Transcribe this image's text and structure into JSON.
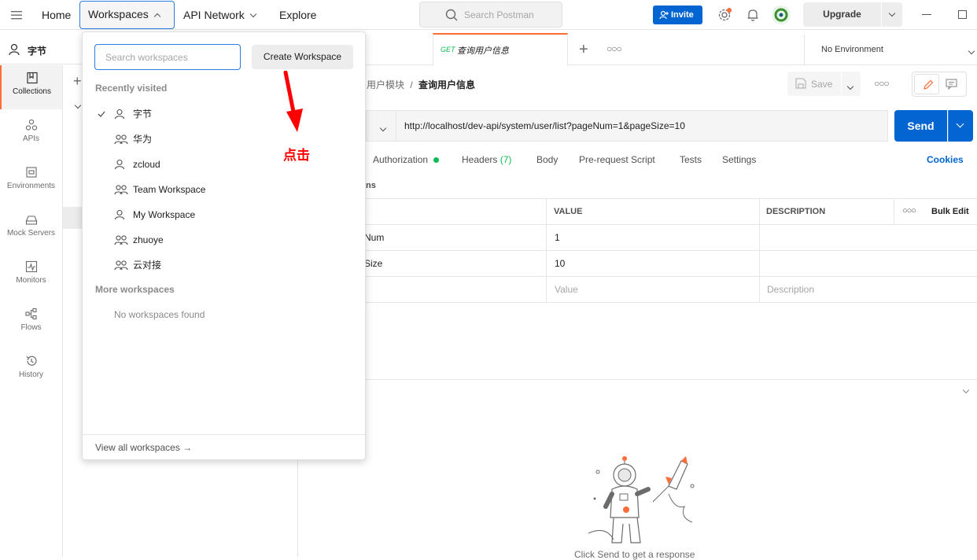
{
  "topbar": {
    "home": "Home",
    "workspaces": "Workspaces",
    "api_network": "API Network",
    "explore": "Explore",
    "search_placeholder": "Search Postman",
    "invite": "Invite",
    "upgrade": "Upgrade"
  },
  "sidebar": {
    "workspace_name": "字节",
    "items": [
      {
        "label": "Collections",
        "icon": "collections-icon"
      },
      {
        "label": "APIs",
        "icon": "apis-icon"
      },
      {
        "label": "Environments",
        "icon": "environments-icon"
      },
      {
        "label": "Mock Servers",
        "icon": "mock-servers-icon"
      },
      {
        "label": "Monitors",
        "icon": "monitors-icon"
      },
      {
        "label": "Flows",
        "icon": "flows-icon"
      },
      {
        "label": "History",
        "icon": "history-icon"
      }
    ]
  },
  "dropdown": {
    "search_placeholder": "Search workspaces",
    "create_button": "Create Workspace",
    "recent_title": "Recently visited",
    "recent": [
      {
        "name": "字节",
        "type": "personal",
        "checked": true
      },
      {
        "name": "华为",
        "type": "team"
      },
      {
        "name": "zcloud",
        "type": "personal"
      },
      {
        "name": "Team Workspace",
        "type": "team"
      },
      {
        "name": "My Workspace",
        "type": "personal"
      },
      {
        "name": "zhuoye",
        "type": "team"
      },
      {
        "name": "云对接",
        "type": "team"
      }
    ],
    "more_title": "More workspaces",
    "empty_text": "No workspaces found",
    "view_all": "View all workspaces →"
  },
  "annotation": {
    "text": "点击",
    "color": "#ff0000"
  },
  "tabs": {
    "active": {
      "method": "GET",
      "title": "查询用户信息"
    },
    "environment": "No Environment"
  },
  "request": {
    "breadcrumb_parent": "用户模块",
    "breadcrumb_sep": "/",
    "breadcrumb_current": "查询用户信息",
    "save": "Save",
    "url": "http://localhost/dev-api/system/user/list?pageNum=1&pageSize=10",
    "send": "Send",
    "subtabs": {
      "authorization": "Authorization",
      "headers": "Headers",
      "headers_count": "(7)",
      "body": "Body",
      "prerequest": "Pre-request Script",
      "tests": "Tests",
      "settings": "Settings",
      "cookies": "Cookies"
    },
    "params_title": "ns",
    "table": {
      "col_value": "VALUE",
      "col_desc": "DESCRIPTION",
      "bulk_edit": "Bulk Edit",
      "rows": [
        {
          "key": "Num",
          "value": "1",
          "desc": ""
        },
        {
          "key": "Size",
          "value": "10",
          "desc": ""
        }
      ],
      "value_placeholder": "Value",
      "desc_placeholder": "Description"
    }
  },
  "response": {
    "hint": "Click Send to get a response"
  },
  "colors": {
    "accent": "#ff6c37",
    "primary": "#0265d2",
    "green": "#0cbb52"
  }
}
